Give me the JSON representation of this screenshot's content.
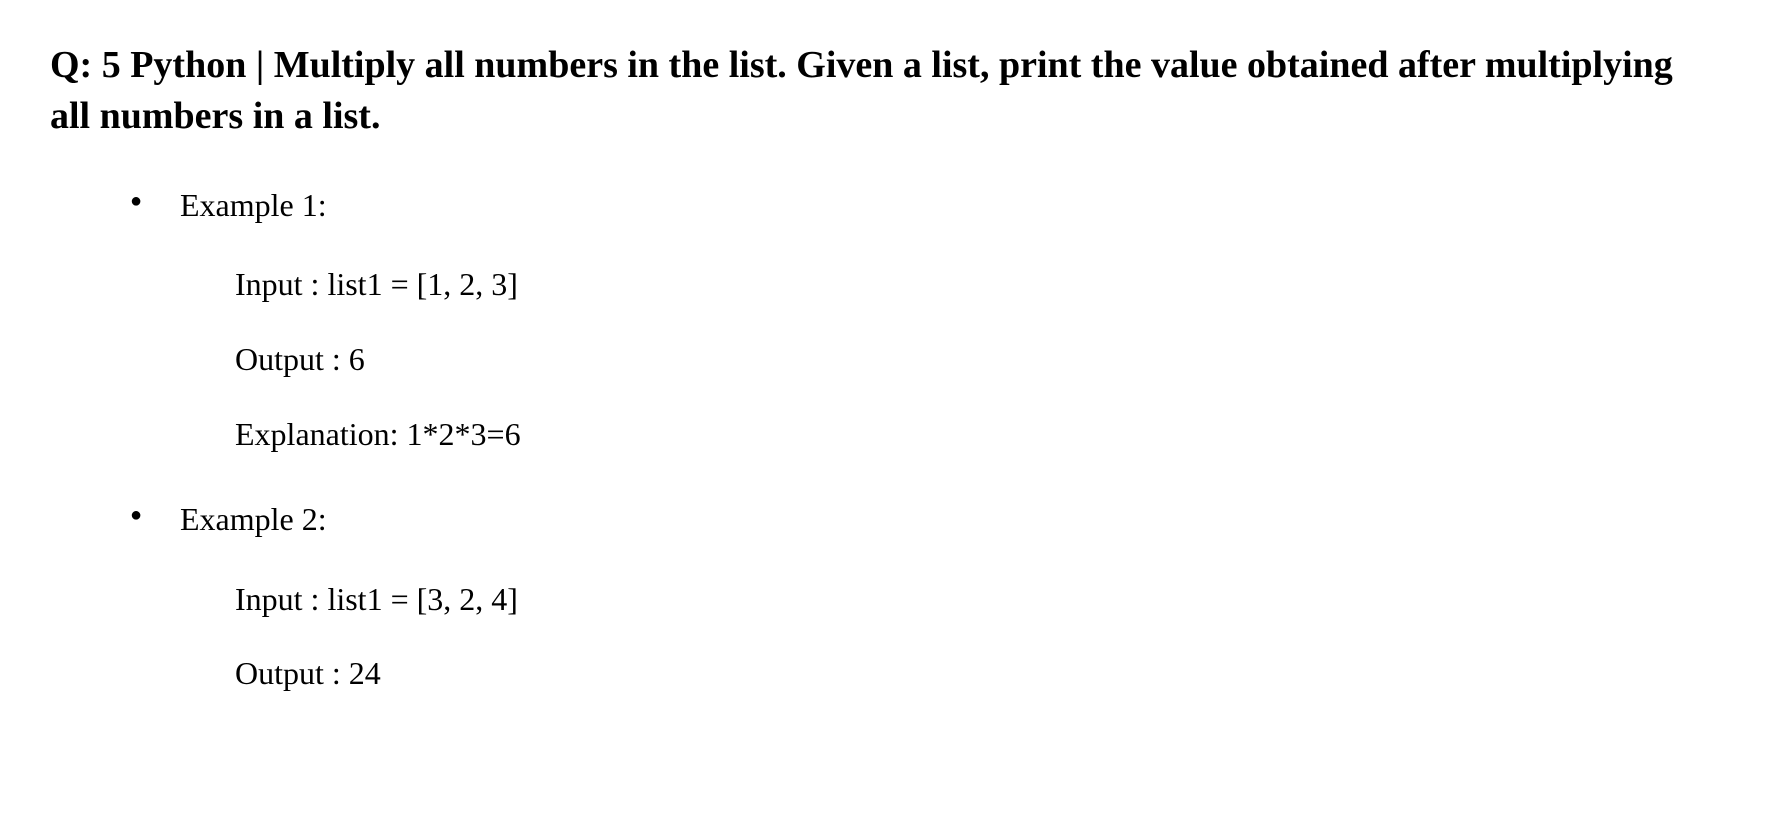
{
  "heading": "Q: 5 Python | Multiply all numbers in the list. Given a list, print the value obtained after multiplying all numbers in a list.",
  "examples": [
    {
      "title": "Example 1:",
      "input": "Input :  list1 = [1, 2, 3]",
      "output": "Output : 6",
      "explanation": "Explanation: 1*2*3=6"
    },
    {
      "title": "Example 2:",
      "input": "Input : list1 = [3, 2, 4]",
      "output": "Output : 24"
    }
  ]
}
